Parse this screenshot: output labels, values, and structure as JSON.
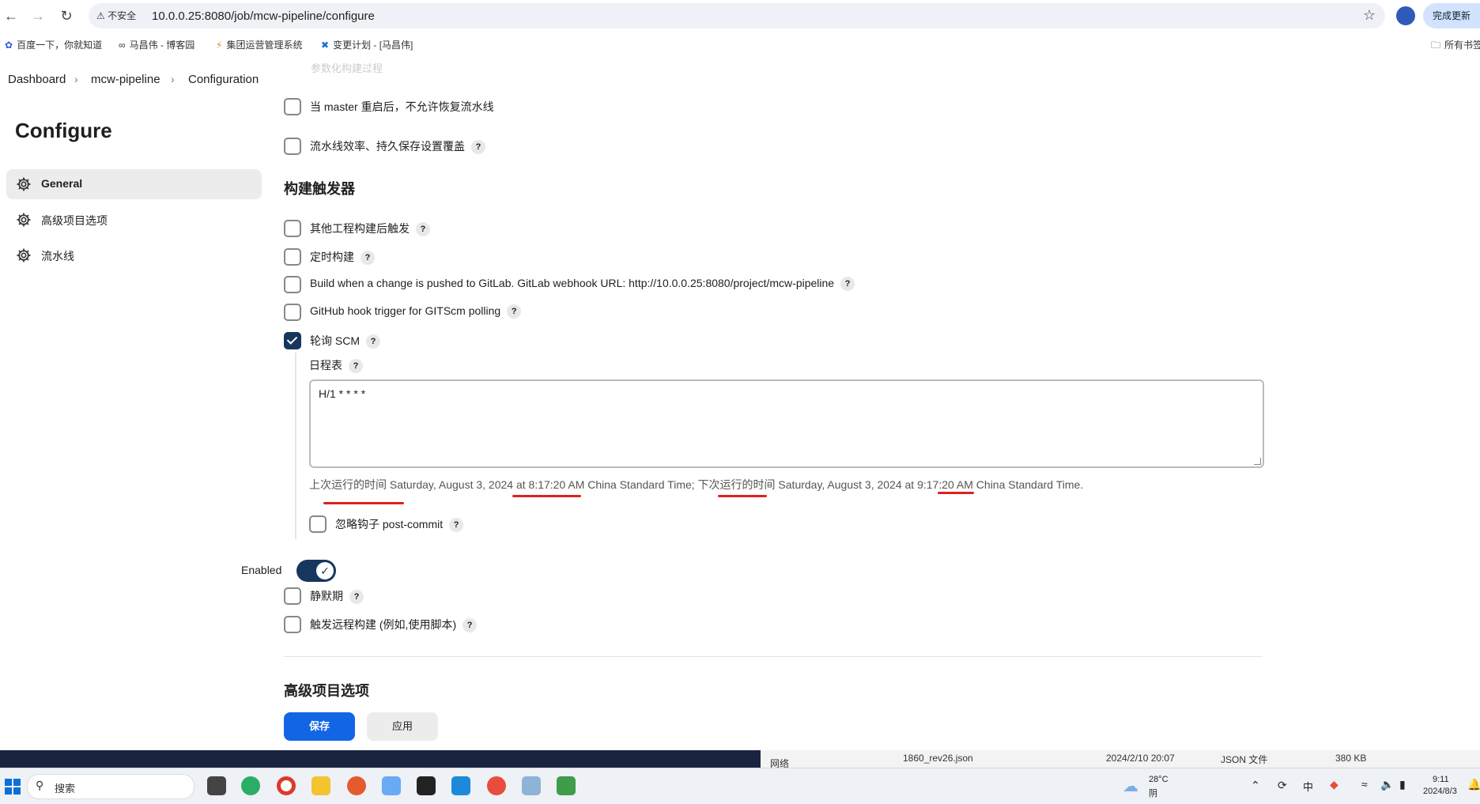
{
  "browser": {
    "security_label": "不安全",
    "url": "10.0.0.25:8080/job/mcw-pipeline/configure",
    "update_label": "完成更新",
    "bookmarks": [
      "百度一下，你就知道",
      "马昌伟 - 博客园",
      "集团运营管理系统",
      "变更计划 - [马昌伟]"
    ],
    "all_bookmarks": "所有书签"
  },
  "breadcrumb": {
    "items": [
      "Dashboard",
      "mcw-pipeline",
      "Configuration"
    ],
    "faded_text": "参数化构建过程"
  },
  "sidebar": {
    "title": "Configure",
    "items": [
      {
        "label": "General"
      },
      {
        "label": "高级项目选项"
      },
      {
        "label": "流水线"
      }
    ]
  },
  "general": {
    "options_top": [
      {
        "label": "当 master 重启后，不允许恢复流水线",
        "checked": false
      },
      {
        "label": "流水线效率、持久保存设置覆盖",
        "checked": false
      }
    ]
  },
  "triggers": {
    "title": "构建触发器",
    "items": [
      {
        "label": "其他工程构建后触发",
        "checked": false
      },
      {
        "label": "定时构建",
        "checked": false
      },
      {
        "label": "Build when a change is pushed to GitLab. GitLab webhook URL: http://10.0.0.25:8080/project/mcw-pipeline",
        "checked": false
      },
      {
        "label": "GitHub hook trigger for GITScm polling",
        "checked": false
      },
      {
        "label": "轮询 SCM",
        "checked": true
      }
    ],
    "schedule_label": "日程表",
    "schedule_value": "H/1 * * * *",
    "run_times": "上次运行的时间 Saturday, August 3, 2024 at 8:17:20 AM China Standard Time; 下次运行的时间 Saturday, August 3, 2024 at 9:17:20 AM China Standard Time.",
    "ignore_hook_label": "忽略钩子 post-commit",
    "enabled_label": "Enabled",
    "enabled": true,
    "after_items": [
      {
        "label": "静默期",
        "checked": false
      },
      {
        "label": "触发远程构建 (例如,使用脚本)",
        "checked": false
      }
    ]
  },
  "advanced_section_title": "高级项目选项",
  "buttons": {
    "save": "保存",
    "apply": "应用"
  },
  "background_window": {
    "file_name": "1860_rev26.json",
    "date": "2024/2/10 20:07",
    "type": "JSON 文件",
    "size": "380 KB",
    "tree_item": "网络"
  },
  "taskbar": {
    "search_placeholder": "搜索",
    "weather_temp": "28°C",
    "weather_desc": "阴",
    "ime": "中",
    "time": "9:11",
    "date": "2024/8/3"
  },
  "colors": {
    "primary": "#1266e6",
    "checked": "#17365d",
    "annotation": "#e02020"
  }
}
